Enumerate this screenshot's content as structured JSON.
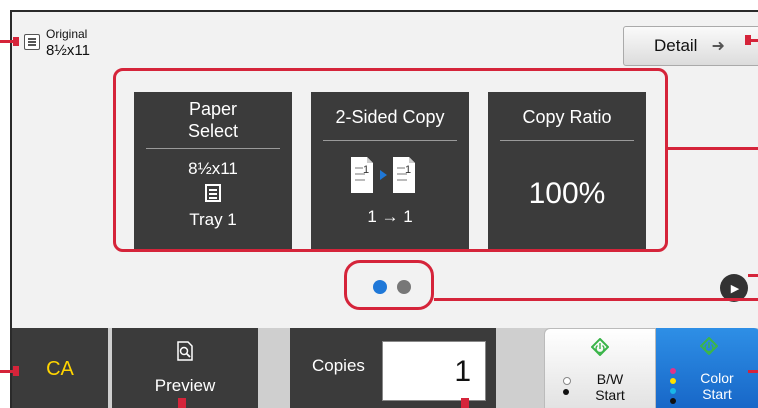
{
  "original": {
    "label": "Original",
    "size": "8½x11"
  },
  "detail_button": {
    "label": "Detail"
  },
  "tiles": [
    {
      "title_line1": "Paper",
      "title_line2": "Select",
      "size": "8½x11",
      "tray": "Tray 1"
    },
    {
      "title": "2-Sided Copy",
      "mode": "1 → 1"
    },
    {
      "title": "Copy Ratio",
      "value": "100%"
    }
  ],
  "pager": {
    "pages": 2,
    "current": 1
  },
  "bottom": {
    "ca_label": "CA",
    "preview_label": "Preview",
    "copies_label": "Copies",
    "copies_value": "1",
    "bw_start_line1": "B/W",
    "bw_start_line2": "Start",
    "color_start_line1": "Color",
    "color_start_line2": "Start"
  },
  "colors": {
    "callout": "#d5243a",
    "tile_bg": "#3b3b3b",
    "ca_text": "#ffd400",
    "start_green": "#3bb54a",
    "color_start_bg": "#1f78d8",
    "dot_active": "#1f78d8",
    "dot_inactive": "#777777"
  }
}
